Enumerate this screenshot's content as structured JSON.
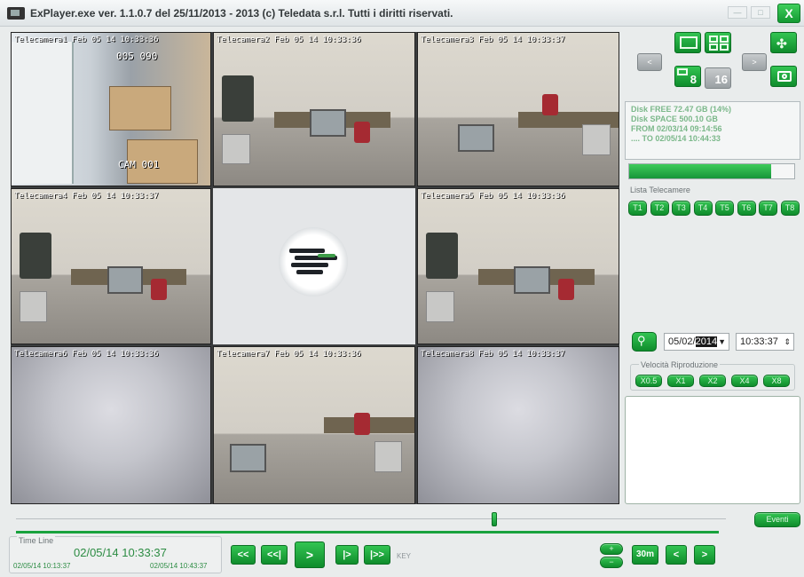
{
  "window": {
    "title": "ExPlayer.exe ver. 1.1.0.7 del 25/11/2013 - 2013 (c) Teledata s.r.l. Tutti i diritti riservati.",
    "close_label": "X"
  },
  "cameras": [
    {
      "label": "Telecamera1 Feb 05 14 10:33:36",
      "overlay_top": "005  090",
      "overlay_bottom": "CAM 001"
    },
    {
      "label": "Telecamera2 Feb 05 14 10:33:36"
    },
    {
      "label": "Telecamera3 Feb 05 14 10:33:37"
    },
    {
      "label": "Telecamera4 Feb 05 14 10:33:37"
    },
    {
      "label": "Telecamera5 Feb 05 14 10:33:36"
    },
    {
      "label": "Telecamera6 Feb 05 14 10:33:36"
    },
    {
      "label": "Telecamera7 Feb 05 14 10:33:36"
    },
    {
      "label": "Telecamera8 Feb 05 14 10:33:37"
    }
  ],
  "side": {
    "nav_prev": "<",
    "nav_next": ">",
    "view8": "8",
    "view16": "16",
    "disk": {
      "free": "Disk FREE   72.47 GB (14%)",
      "space": "Disk SPACE 500.10 GB",
      "from": "FROM 02/03/14 09:14:56",
      "to": ".... TO 02/05/14 10:44:33"
    },
    "disk_used_fraction": 0.86,
    "lista_label": "Lista Telecamere",
    "cams": [
      "T1",
      "T2",
      "T3",
      "T4",
      "T5",
      "T6",
      "T7",
      "T8"
    ],
    "date_prefix": "05/02/",
    "date_year": "2014",
    "time_value": "10:33:37",
    "velocita_label": "Velocità Riproduzione",
    "speeds": [
      "X0.5",
      "X1",
      "X2",
      "X4",
      "X8"
    ]
  },
  "bottom": {
    "eventi": "Eventi",
    "timeline_title": "Time Line",
    "timeline_main": "02/05/14 10:33:37",
    "timeline_start": "02/05/14 10:13:37",
    "timeline_end": "02/05/14 10:43:37",
    "btn_rewind": "<<",
    "btn_step_back": "<<|",
    "btn_play": ">",
    "btn_step": "|>",
    "btn_fwd": "|>>",
    "key": "KEY",
    "zoom_plus": "+",
    "zoom_minus": "−",
    "btn_30m": "30m",
    "btn_prev": "<",
    "btn_next": ">",
    "slider_position_fraction": 0.67
  }
}
